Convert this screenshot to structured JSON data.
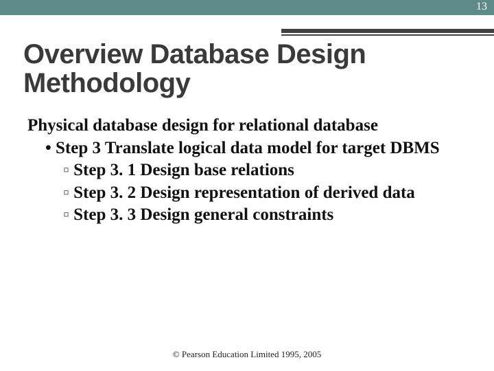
{
  "page_number": "13",
  "title": "Overview Database Design Methodology",
  "section_heading": "Physical database design for relational database",
  "bullets": {
    "step3": "Step 3  Translate logical data model for target DBMS",
    "sub": [
      "Step 3. 1  Design base relations",
      "Step 3. 2  Design representation of derived data",
      "Step 3. 3  Design general constraints"
    ]
  },
  "footer": "© Pearson Education Limited 1995, 2005"
}
